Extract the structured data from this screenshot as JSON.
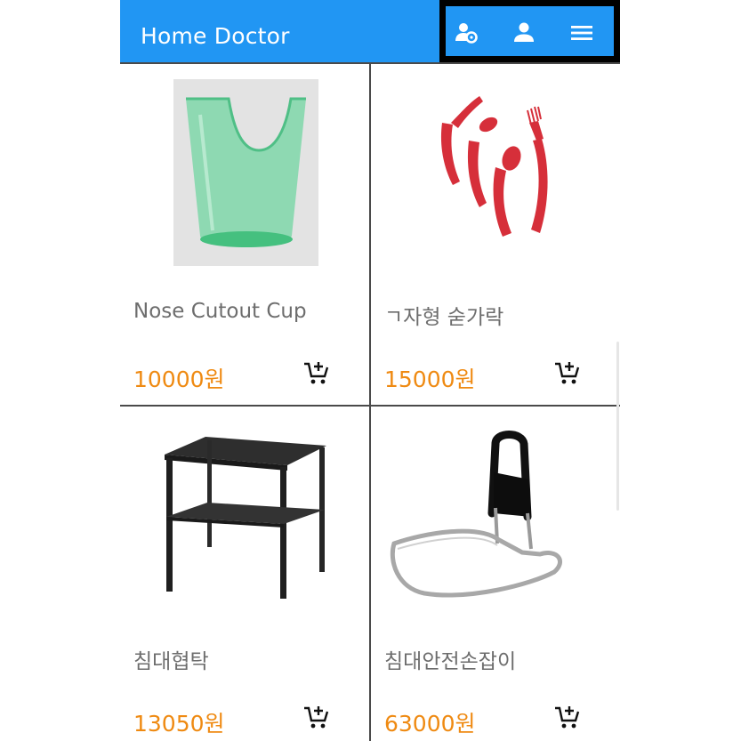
{
  "app": {
    "title": "Home Doctor"
  },
  "header_actions": [
    {
      "icon": "user-settings-icon"
    },
    {
      "icon": "person-icon"
    },
    {
      "icon": "menu-icon"
    }
  ],
  "products": [
    {
      "name": "Nose Cutout Cup",
      "price": "10000원",
      "image": "nose-cutout-cup-image"
    },
    {
      "name": "ㄱ자형 숟가락",
      "price": "15000원",
      "image": "bent-spoon-set-image"
    },
    {
      "name": "침대협탁",
      "price": "13050원",
      "image": "bedside-table-image"
    },
    {
      "name": "침대안전손잡이",
      "price": "63000원",
      "image": "bed-safety-rail-image"
    }
  ],
  "colors": {
    "appbar": "#2196F3",
    "price": "#ef8a12",
    "name": "#6d6d6d"
  },
  "icons": {
    "cart": "add-to-cart-icon"
  }
}
